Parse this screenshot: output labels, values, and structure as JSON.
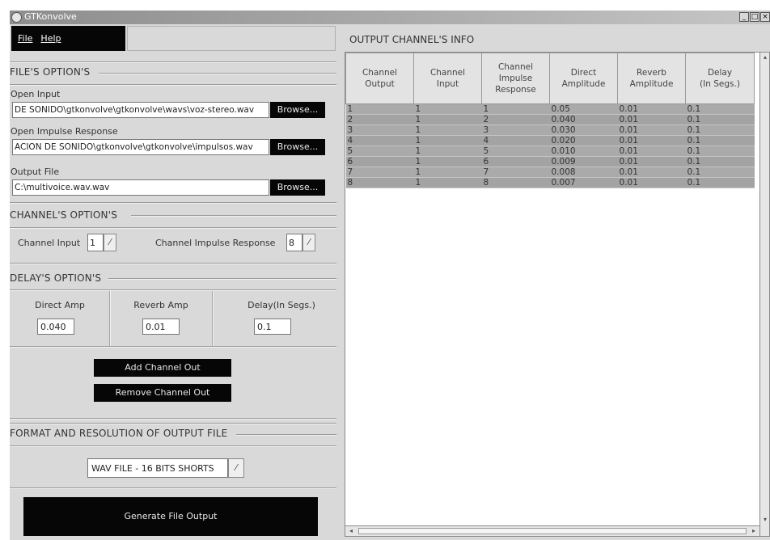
{
  "window": {
    "title": "GTKonvolve",
    "controls": [
      "_",
      "□",
      "×"
    ]
  },
  "menu": {
    "file": "File",
    "help": "Help"
  },
  "files": {
    "title": "FILE'S OPTION'S",
    "open_input_label": "Open Input",
    "open_input_value": "DE SONIDO\\gtkonvolve\\gtkonvolve\\wavs\\voz-stereo.wav",
    "open_impulse_label": "Open Impulse Response",
    "open_impulse_value": "ACION DE SONIDO\\gtkonvolve\\gtkonvolve\\impulsos.wav",
    "output_label": "Output File",
    "output_value": "C:\\multivoice.wav.wav",
    "browse_label": "Browse..."
  },
  "channels": {
    "title": "CHANNEL'S OPTION'S",
    "input_label": "Channel Input",
    "input_value": "1",
    "impulse_label": "Channel Impulse Response",
    "impulse_value": "8"
  },
  "delay": {
    "title": "DELAY'S OPTION'S",
    "direct_label": "Direct Amp",
    "direct_value": "0.040",
    "reverb_label": "Reverb Amp",
    "reverb_value": "0.01",
    "delay_label": "Delay(In Segs.)",
    "delay_value": "0.1",
    "add_label": "Add Channel Out",
    "remove_label": "Remove Channel Out"
  },
  "format": {
    "title": "FORMAT AND RESOLUTION OF OUTPUT FILE",
    "selected": "WAV FILE - 16 BITS SHORTS",
    "generate_label": "Generate File Output"
  },
  "output_info": {
    "title": "OUTPUT CHANNEL'S INFO",
    "headers": [
      [
        "Channel",
        "Output"
      ],
      [
        "Channel",
        "Input"
      ],
      [
        "Channel",
        "Impulse",
        "Response"
      ],
      [
        "Direct",
        "Amplitude"
      ],
      [
        "Reverb",
        "Amplitude"
      ],
      [
        "Delay",
        "(In Segs.)"
      ]
    ],
    "rows": [
      [
        "1",
        "1",
        "1",
        "0.05",
        "0.01",
        "0.1"
      ],
      [
        "2",
        "1",
        "2",
        "0.040",
        "0.01",
        "0.1"
      ],
      [
        "3",
        "1",
        "3",
        "0.030",
        "0.01",
        "0.1"
      ],
      [
        "4",
        "1",
        "4",
        "0.020",
        "0.01",
        "0.1"
      ],
      [
        "5",
        "1",
        "5",
        "0.010",
        "0.01",
        "0.1"
      ],
      [
        "6",
        "1",
        "6",
        "0.009",
        "0.01",
        "0.1"
      ],
      [
        "7",
        "1",
        "7",
        "0.008",
        "0.01",
        "0.1"
      ],
      [
        "8",
        "1",
        "8",
        "0.007",
        "0.01",
        "0.1"
      ]
    ]
  }
}
